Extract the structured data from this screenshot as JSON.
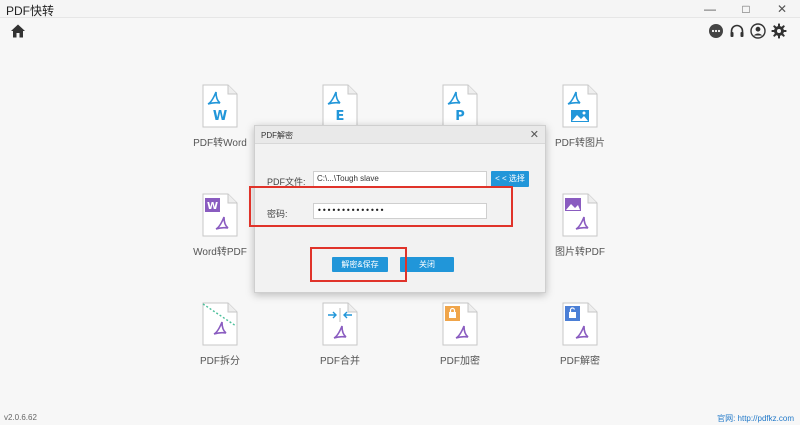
{
  "app": {
    "title": "PDF快转"
  },
  "window_controls": {
    "minimize": "—",
    "maximize": "□",
    "close": "✕"
  },
  "toolbar": {
    "icons": [
      "home-icon",
      "chat-icon",
      "headset-icon",
      "user-icon",
      "gear-icon"
    ]
  },
  "tools": [
    {
      "label": "PDF转Word",
      "letter": "W",
      "color": "#2196d9"
    },
    {
      "label": "",
      "letter": "E",
      "color": "#2196d9"
    },
    {
      "label": "",
      "letter": "P",
      "color": "#2196d9"
    },
    {
      "label": "PDF转图片",
      "letter": "",
      "color": "#2196d9"
    },
    {
      "label": "Word转PDF",
      "letter": "W",
      "color": "#8a5cc0"
    },
    {
      "label": "图片转PDF",
      "letter": "",
      "color": "#8a5cc0"
    },
    {
      "label": "PDF拆分",
      "letter": "",
      "color": "#9a7cc9"
    },
    {
      "label": "PDF合并",
      "letter": "",
      "color": "#8a5cc0"
    },
    {
      "label": "PDF加密",
      "letter": "",
      "color": "#f0a54a"
    },
    {
      "label": "PDF解密",
      "letter": "",
      "color": "#4b7fd6"
    }
  ],
  "dialog": {
    "title": "PDF解密",
    "close": "✕",
    "file_label": "PDF文件:",
    "file_value": "C:\\...\\Tough slave",
    "select_button": "< < 选择",
    "password_label": "密码:",
    "password_value": "••••••••••••••",
    "decrypt_button": "解密&保存",
    "close_button": "关闭"
  },
  "footer": {
    "version": "v2.0.6.62",
    "site": "官网: http://pdfkz.com"
  },
  "colors": {
    "accent": "#2196d9",
    "highlight": "#e0332a"
  }
}
